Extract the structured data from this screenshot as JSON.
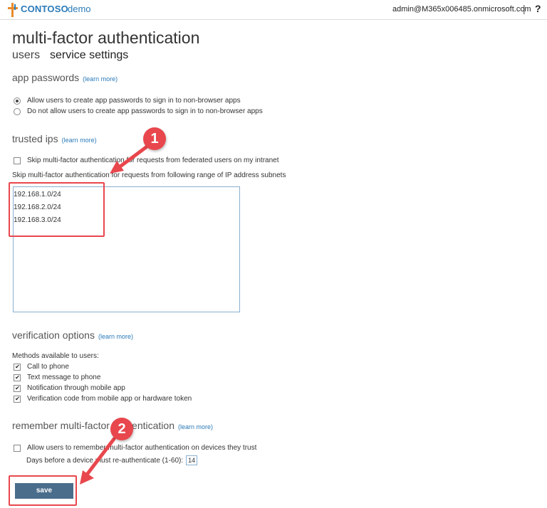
{
  "header": {
    "brand": "CONTOSO",
    "brand_sub": "demo",
    "user": "admin@M365x006485.onmicrosoft.com",
    "separator": "|",
    "help": "?"
  },
  "page": {
    "title": "multi-factor authentication",
    "tabs": [
      "users",
      "service settings"
    ]
  },
  "app_passwords": {
    "title": "app passwords",
    "learn_more": "(learn more)",
    "options": [
      {
        "label": "Allow users to create app passwords to sign in to non-browser apps",
        "selected": true
      },
      {
        "label": "Do not allow users to create app passwords to sign in to non-browser apps",
        "selected": false
      }
    ]
  },
  "trusted_ips": {
    "title": "trusted ips",
    "learn_more": "(learn more)",
    "skip_federated": "Skip multi-factor authentication for requests from federated users on my intranet",
    "skip_federated_checked": false,
    "subnet_label": "Skip multi-factor authentication for requests from following range of IP address subnets",
    "subnets": [
      "192.168.1.0/24",
      "192.168.2.0/24",
      "192.168.3.0/24"
    ]
  },
  "verification_options": {
    "title": "verification options",
    "learn_more": "(learn more)",
    "methods_label": "Methods available to users:",
    "methods": [
      {
        "label": "Call to phone",
        "checked": true
      },
      {
        "label": "Text message to phone",
        "checked": true
      },
      {
        "label": "Notification through mobile app",
        "checked": true
      },
      {
        "label": "Verification code from mobile app or hardware token",
        "checked": true
      }
    ]
  },
  "remember_mfa": {
    "title": "remember multi-factor authentication",
    "learn_more": "(learn more)",
    "allow_label": "Allow users to remember multi-factor authentication on devices they trust",
    "allow_checked": false,
    "days_label": "Days before a device must re-authenticate (1-60):",
    "days_value": "14"
  },
  "actions": {
    "save_label": "save"
  },
  "callouts": [
    "1",
    "2"
  ],
  "colors": {
    "brand": "#2a7ab8",
    "callout": "#e8474d",
    "save_button": "#4a6d8c"
  }
}
